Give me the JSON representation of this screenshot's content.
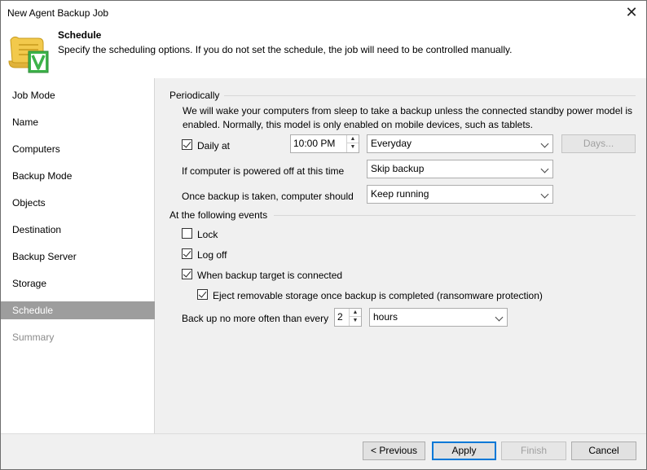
{
  "window": {
    "title": "New Agent Backup Job"
  },
  "header": {
    "title": "Schedule",
    "description": "Specify the scheduling options. If you do not set the schedule, the job will need to be controlled manually."
  },
  "nav": [
    {
      "label": "Job Mode",
      "state": "normal"
    },
    {
      "label": "Name",
      "state": "normal"
    },
    {
      "label": "Computers",
      "state": "normal"
    },
    {
      "label": "Backup Mode",
      "state": "normal"
    },
    {
      "label": "Objects",
      "state": "normal"
    },
    {
      "label": "Destination",
      "state": "normal"
    },
    {
      "label": "Backup Server",
      "state": "normal"
    },
    {
      "label": "Storage",
      "state": "normal"
    },
    {
      "label": "Schedule",
      "state": "active"
    },
    {
      "label": "Summary",
      "state": "disabled"
    }
  ],
  "periodically": {
    "section_label": "Periodically",
    "info_line1": "We will wake your computers from sleep to take a backup unless the connected standby power model is",
    "info_line2": "enabled. Normally, this model is only enabled on mobile devices, such as tablets.",
    "daily_label": "Daily at",
    "daily_checked": true,
    "time_value": "10:00 PM",
    "frequency_value": "Everyday",
    "days_button": "Days...",
    "powered_off_label": "If computer is powered off at this time",
    "powered_off_value": "Skip backup",
    "after_backup_label": "Once backup is taken, computer should",
    "after_backup_value": "Keep running"
  },
  "events": {
    "section_label": "At the following events",
    "lock_label": "Lock",
    "lock_checked": false,
    "logoff_label": "Log off",
    "logoff_checked": true,
    "target_label": "When backup target is connected",
    "target_checked": true,
    "eject_label": "Eject removable storage once backup is completed (ransomware protection)",
    "eject_checked": true,
    "backup_freq_label": "Back up no more often than every",
    "backup_freq_value": "2",
    "backup_freq_unit": "hours"
  },
  "footer": {
    "previous": "< Previous",
    "apply": "Apply",
    "finish": "Finish",
    "cancel": "Cancel"
  }
}
